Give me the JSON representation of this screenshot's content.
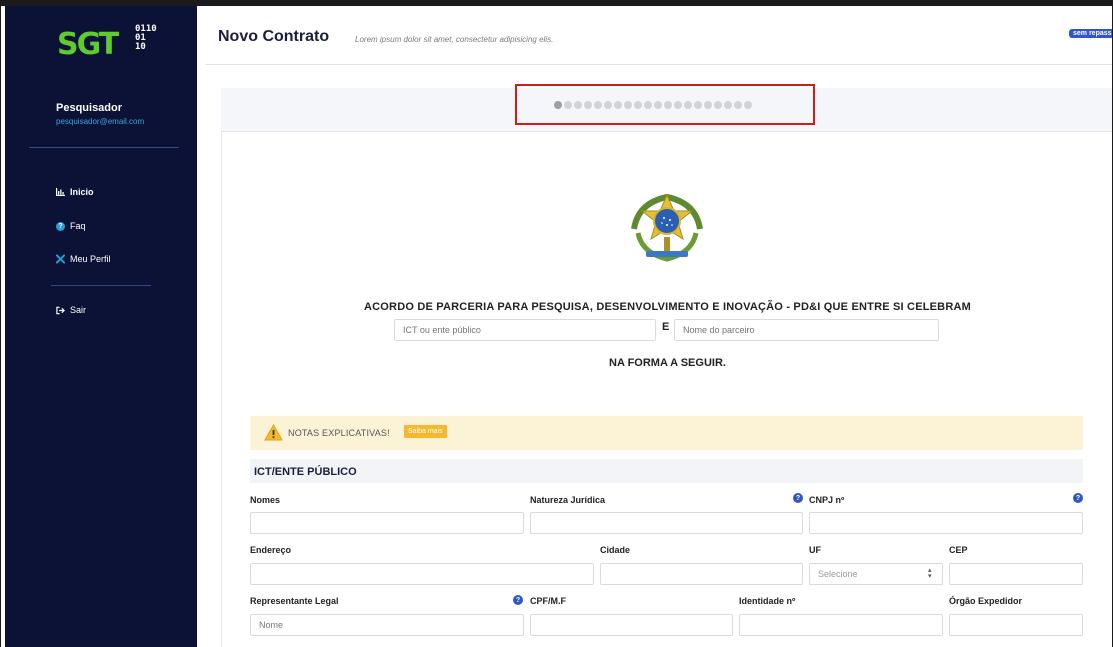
{
  "sidebar": {
    "logo_text": "SGT",
    "logo_bits": [
      "0110",
      "01",
      "10"
    ],
    "user_name": "Pesquisador",
    "user_email": "pesquisador@email.com",
    "items": [
      {
        "label": "Inicio",
        "icon": "chart-icon"
      },
      {
        "label": "Faq",
        "icon": "question-icon"
      },
      {
        "label": "Meu Perfil",
        "icon": "tools-icon"
      },
      {
        "label": "Sair",
        "icon": "sign-out-icon"
      }
    ]
  },
  "header": {
    "title": "Novo Contrato",
    "subtitle": "Lorem ipsum dolor sit amet, consectetur adipisicing elis.",
    "badge": "sem repass"
  },
  "stepper": {
    "total_steps": 20,
    "current_step": 1
  },
  "document": {
    "title": "ACORDO DE PARCERIA PARA PESQUISA, DESENVOLVIMENTO E INOVAÇÃO - PD&I QUE ENTRE SI CELEBRAM",
    "party1_placeholder": "ICT ou ente público",
    "connector": "E",
    "party2_placeholder": "Nome do parceiro",
    "subtitle": "NA FORMA A SEGUIR."
  },
  "notes": {
    "text": "NOTAS EXPLICATIVAS!",
    "button": "Saiba mais"
  },
  "section": {
    "title": "ICT/ENTE PÚBLICO",
    "labels": {
      "nomes": "Nomes",
      "natureza": "Natureza Jurídica",
      "cnpj": "CNPJ nº",
      "endereco": "Endereço",
      "cidade": "Cidade",
      "uf": "UF",
      "cep": "CEP",
      "representante": "Representante Legal",
      "cpf": "CPF/M.F",
      "identidade": "Identidade nº",
      "orgao": "Órgão Expedidor"
    },
    "uf_select": "Selecione",
    "representante_placeholder": "Nome",
    "help_glyph": "?"
  },
  "colors": {
    "sidebar_bg": "#0b1236",
    "logo_green": "#5ecb2e",
    "accent_blue": "#3157c4",
    "highlight_red": "#d11c1c",
    "notes_bg": "#fcf2d6",
    "saiba_btn": "#f5b82e"
  }
}
